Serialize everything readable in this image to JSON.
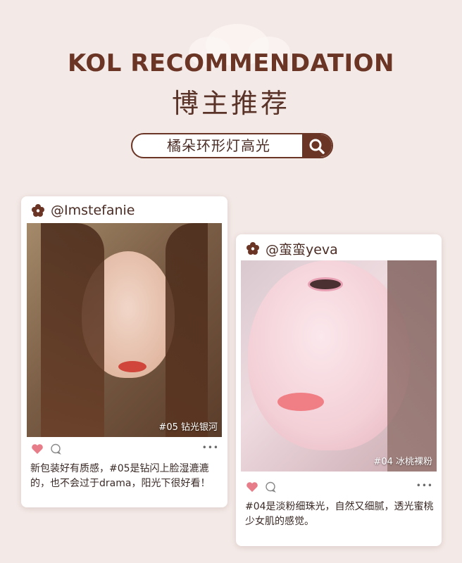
{
  "header": {
    "title_en": "KOL RECOMMENDATION",
    "title_cn": "博主推荐"
  },
  "search": {
    "text": "橘朵环形灯高光",
    "icon": "search-icon"
  },
  "colors": {
    "brand_brown": "#6b3526",
    "background": "#f3e9e6",
    "like_pink": "#e87d8a"
  },
  "posts": [
    {
      "handle": "@Imstefanie",
      "photo_label": "#05 钻光银河",
      "caption": "新包装好有质感，#05是钻闪上脸湿漉漉的，也不会过于drama，阳光下很好看！",
      "icons": [
        "flower-icon",
        "heart-icon",
        "comment-icon",
        "more-icon"
      ]
    },
    {
      "handle": "@蛮蛮yeva",
      "photo_label": "#04 冰桃裸粉",
      "caption": "#04是淡粉细珠光，自然又细腻，透光蜜桃少女肌的感觉。",
      "icons": [
        "flower-icon",
        "heart-icon",
        "comment-icon",
        "more-icon"
      ]
    }
  ]
}
